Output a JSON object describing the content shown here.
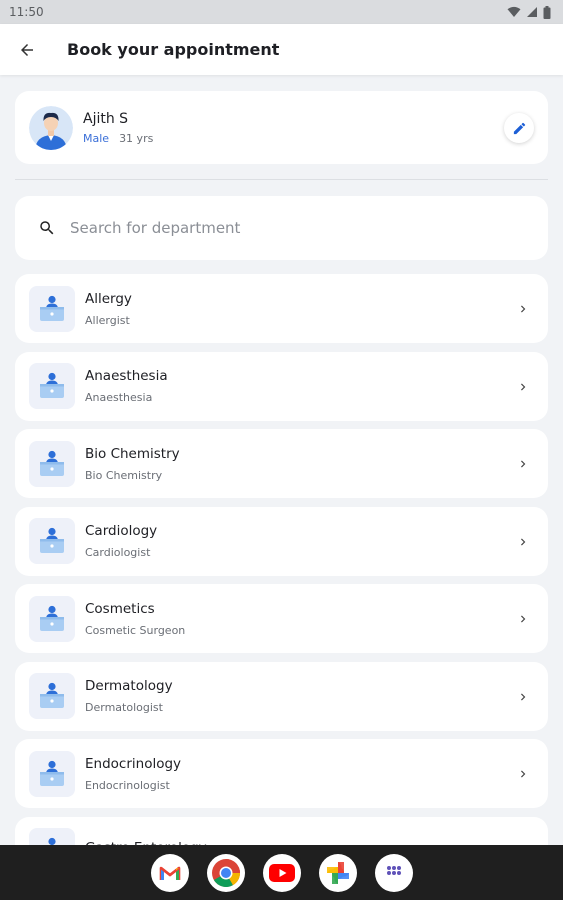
{
  "status_bar": {
    "time": "11:50"
  },
  "header": {
    "title": "Book your appointment"
  },
  "patient": {
    "name": "Ajith S",
    "gender": "Male",
    "age": "31 yrs"
  },
  "search": {
    "placeholder": "Search for department"
  },
  "departments": [
    {
      "name": "Allergy",
      "subtitle": "Allergist"
    },
    {
      "name": "Anaesthesia",
      "subtitle": "Anaesthesia"
    },
    {
      "name": "Bio Chemistry",
      "subtitle": "Bio Chemistry"
    },
    {
      "name": "Cardiology",
      "subtitle": "Cardiologist"
    },
    {
      "name": "Cosmetics",
      "subtitle": "Cosmetic Surgeon"
    },
    {
      "name": "Dermatology",
      "subtitle": "Dermatologist"
    },
    {
      "name": "Endocrinology",
      "subtitle": "Endocrinologist"
    },
    {
      "name": "Gastro Enterology",
      "subtitle": ""
    }
  ],
  "dock": {
    "apps": [
      {
        "icon": "gmail-icon"
      },
      {
        "icon": "chrome-icon"
      },
      {
        "icon": "youtube-icon"
      },
      {
        "icon": "photos-icon"
      },
      {
        "icon": "app-drawer-icon"
      }
    ]
  },
  "colors": {
    "accent": "#3a6fd8",
    "background": "#f1f3f6",
    "card": "#ffffff",
    "edit_icon": "#1d5fd6"
  }
}
